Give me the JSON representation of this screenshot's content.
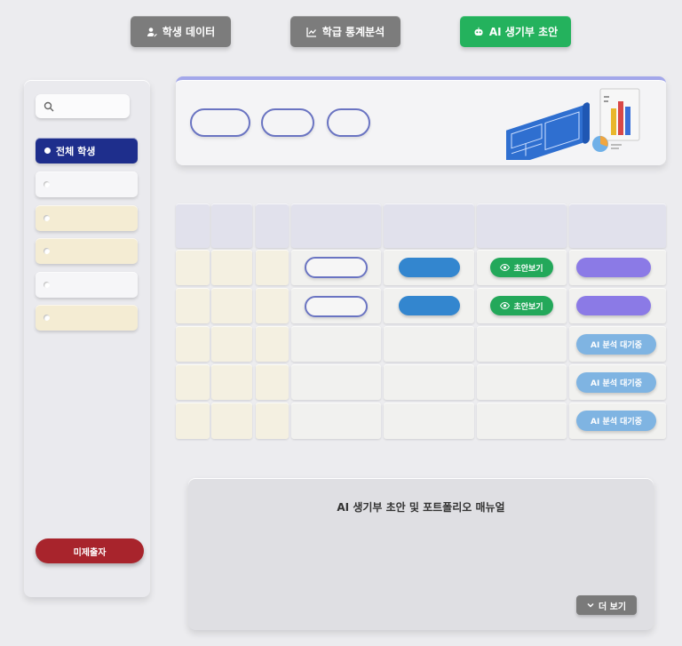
{
  "nav": {
    "student_data": "학생 데이터",
    "class_stats": "학급 통계분석",
    "ai_draft": "AI 생기부 초안"
  },
  "sidebar": {
    "items": [
      {
        "label": "전체 학생",
        "active": true
      },
      {
        "label": "",
        "style": "white"
      },
      {
        "label": "",
        "style": "cream"
      },
      {
        "label": "",
        "style": "cream"
      },
      {
        "label": "",
        "style": "white"
      },
      {
        "label": "",
        "style": "cream"
      }
    ],
    "unsubmitted_button": "미제출자"
  },
  "table": {
    "rows": [
      {
        "view_draft": "초안보기"
      },
      {
        "view_draft": "초안보기"
      },
      {
        "status": "AI 분석 대기중"
      },
      {
        "status": "AI 분석 대기중"
      },
      {
        "status": "AI 분석 대기중"
      }
    ]
  },
  "manual": {
    "title": "AI 생기부 초안 및 포트폴리오 매뉴얼",
    "more_button": "더 보기"
  },
  "colors": {
    "active_navy": "#1e2e8c",
    "green": "#24b25d",
    "red": "#a8242c",
    "accent_purple": "#a3a7ea"
  }
}
